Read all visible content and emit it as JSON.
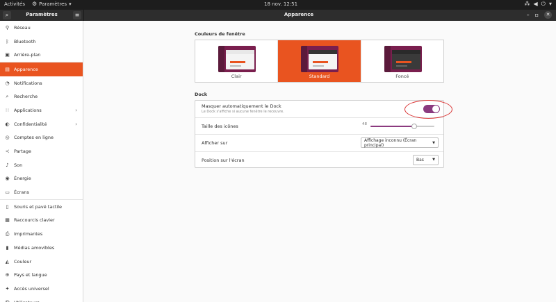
{
  "topbar": {
    "activities": "Activités",
    "app_menu": "Paramètres",
    "clock": "18 nov.  12:51"
  },
  "headerbar": {
    "sidebar_title": "Paramètres",
    "title": "Apparence"
  },
  "sidebar": {
    "items": [
      {
        "label": "Réseau",
        "icon": "network-icon"
      },
      {
        "label": "Bluetooth",
        "icon": "bluetooth-icon"
      },
      {
        "label": "Arrière-plan",
        "icon": "background-icon"
      },
      {
        "label": "Apparence",
        "icon": "appearance-icon",
        "active": true
      },
      {
        "label": "Notifications",
        "icon": "notifications-icon"
      },
      {
        "label": "Recherche",
        "icon": "search-icon"
      },
      {
        "label": "Applications",
        "icon": "applications-icon",
        "has_chevron": true
      },
      {
        "label": "Confidentialité",
        "icon": "privacy-icon",
        "has_chevron": true
      },
      {
        "label": "Comptes en ligne",
        "icon": "online-accounts-icon"
      },
      {
        "label": "Partage",
        "icon": "share-icon"
      },
      {
        "label": "Son",
        "icon": "sound-icon"
      },
      {
        "label": "Énergie",
        "icon": "power-icon"
      },
      {
        "label": "Écrans",
        "icon": "displays-icon"
      },
      {
        "label": "Souris et pavé tactile",
        "icon": "mouse-icon"
      },
      {
        "label": "Raccourcis clavier",
        "icon": "keyboard-icon"
      },
      {
        "label": "Imprimantes",
        "icon": "printer-icon"
      },
      {
        "label": "Médias amovibles",
        "icon": "removable-media-icon"
      },
      {
        "label": "Couleur",
        "icon": "color-icon"
      },
      {
        "label": "Pays et langue",
        "icon": "language-icon"
      },
      {
        "label": "Accès universel",
        "icon": "accessibility-icon"
      },
      {
        "label": "Utilisateurs",
        "icon": "users-icon"
      }
    ]
  },
  "appearance": {
    "window_colors_title": "Couleurs de fenêtre",
    "themes": [
      {
        "label": "Clair",
        "selected": false
      },
      {
        "label": "Standard",
        "selected": true
      },
      {
        "label": "Foncé",
        "selected": false
      }
    ],
    "dock_title": "Dock",
    "autohide_label": "Masquer automatiquement le Dock",
    "autohide_sub": "Le Dock s'affiche si aucune fenêtre le recouvre.",
    "autohide_on": true,
    "icon_size_label": "Taille des icônes",
    "icon_size_value": "48",
    "icon_size_fraction": 0.68,
    "show_on_label": "Afficher sur",
    "show_on_value": "Affichage inconnu (Écran principal)",
    "position_label": "Position sur l'écran",
    "position_value": "Bas"
  },
  "colors": {
    "accent": "#e95420",
    "toggle": "#8b3a7f",
    "highlight": "#d93030"
  }
}
